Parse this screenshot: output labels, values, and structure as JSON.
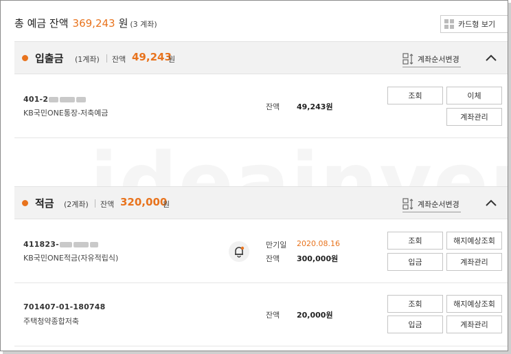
{
  "summary": {
    "label": "총 예금 잔액",
    "amount": "369,243",
    "unit": "원",
    "count": "(3 계좌)"
  },
  "card_view_label": "카드형 보기",
  "sections": [
    {
      "title": "입출금",
      "count": "(1계좌)",
      "balance_label": "잔액",
      "balance": "49,243",
      "unit": "원",
      "order_label": "계좌순서변경",
      "accounts": [
        {
          "number_prefix": "401-2",
          "name": "KB국민ONE통장-저축예금",
          "balance_label": "잔액",
          "balance": "49,243원",
          "buttons": [
            "조회",
            "이체",
            "계좌관리"
          ]
        }
      ]
    },
    {
      "title": "적금",
      "count": "(2계좌)",
      "balance_label": "잔액",
      "balance": "320,000",
      "unit": "원",
      "order_label": "계좌순서변경",
      "accounts": [
        {
          "number_prefix": "411823-",
          "name": "KB국민ONE적금(자유적립식)",
          "maturity_label": "만기일",
          "maturity_date": "2020.08.16",
          "balance_label": "잔액",
          "balance": "300,000원",
          "buttons": [
            "조회",
            "해지예상조회",
            "입금",
            "계좌관리"
          ]
        },
        {
          "number": "701407-01-180748",
          "name": "주택청약종합저축",
          "balance_label": "잔액",
          "balance": "20,000원",
          "buttons": [
            "조회",
            "해지예상조회",
            "입금",
            "계좌관리"
          ]
        }
      ]
    }
  ],
  "watermark": "ideainven",
  "colors": {
    "accent": "#e8731d",
    "header_bg": "#f2f2f2",
    "border": "#c4c4c4"
  },
  "icons": [
    "grid-icon",
    "order-change-icon",
    "chevron-up-icon",
    "bell-icon"
  ]
}
